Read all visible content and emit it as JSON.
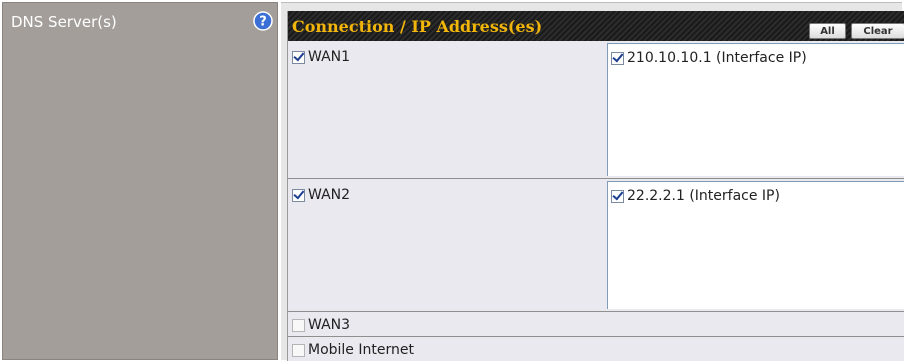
{
  "label": {
    "title": "DNS Server(s)",
    "help_icon": "question-circle-icon"
  },
  "header": {
    "title": "Connection / IP Address(es)",
    "all_label": "All",
    "clear_label": "Clear"
  },
  "connections": [
    {
      "name": "WAN1",
      "checked": true,
      "ips": [
        {
          "label": "210.10.10.1 (Interface IP)",
          "checked": true
        }
      ]
    },
    {
      "name": "WAN2",
      "checked": true,
      "ips": [
        {
          "label": "22.2.2.1 (Interface IP)",
          "checked": true
        }
      ]
    },
    {
      "name": "WAN3",
      "checked": false,
      "ips": []
    },
    {
      "name": "Mobile Internet",
      "checked": false,
      "ips": []
    }
  ],
  "colors": {
    "label_bg": "#a39e9a",
    "header_text": "#f2b50a",
    "header_bg": "#222222",
    "row_bg": "#e9e9ef"
  }
}
